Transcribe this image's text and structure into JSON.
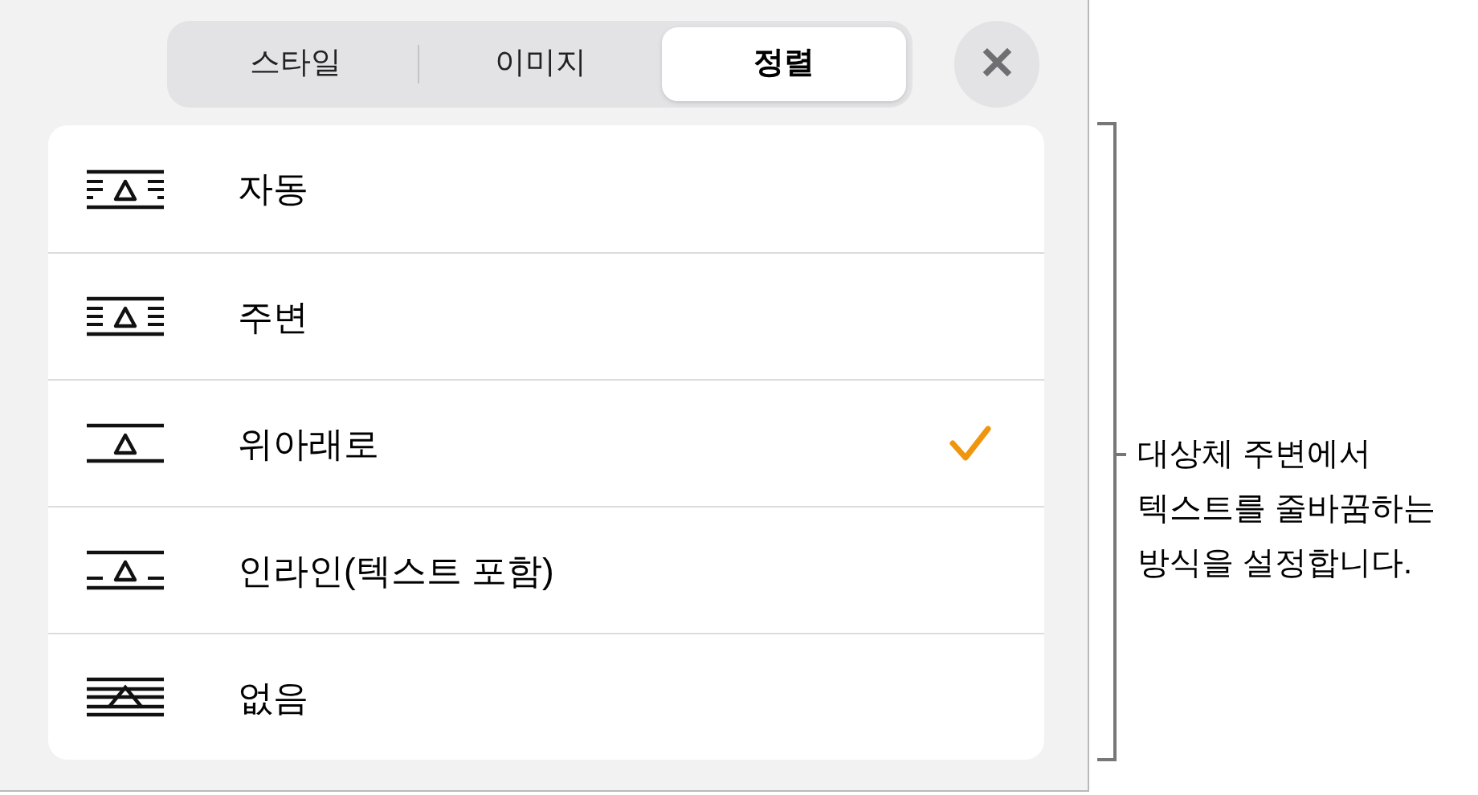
{
  "tabs": [
    {
      "label": "스타일",
      "selected": false
    },
    {
      "label": "이미지",
      "selected": false
    },
    {
      "label": "정렬",
      "selected": true
    }
  ],
  "close_button": {
    "label": "✕"
  },
  "wrap_options": [
    {
      "kind": "auto",
      "label": "자동",
      "selected": false
    },
    {
      "kind": "around",
      "label": "주변",
      "selected": false
    },
    {
      "kind": "above_below",
      "label": "위아래로",
      "selected": true
    },
    {
      "kind": "inline",
      "label": "인라인(텍스트 포함)",
      "selected": false
    },
    {
      "kind": "none",
      "label": "없음",
      "selected": false
    }
  ],
  "callout": {
    "lines": [
      "대상체 주변에서",
      "텍스트를 줄바꿈하는",
      "방식을 설정합니다."
    ]
  }
}
